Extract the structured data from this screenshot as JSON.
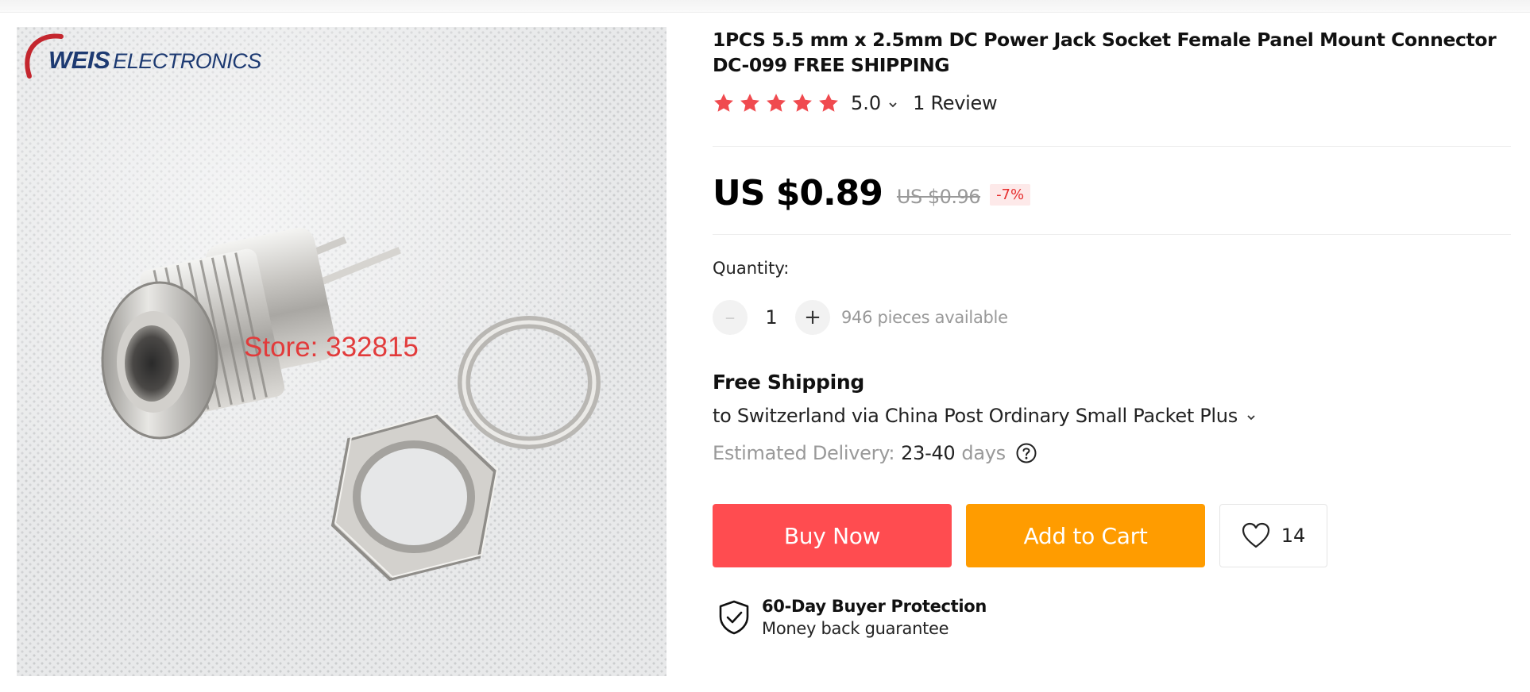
{
  "gallery": {
    "brand_main": "WEIS",
    "brand_sub": "ELECTRONICS",
    "watermark": "Store: 332815"
  },
  "product": {
    "title": "1PCS 5.5 mm x 2.5mm DC Power Jack Socket Female Panel Mount Connector DC-099 FREE SHIPPING",
    "rating_value": "5.0",
    "rating_stars": 5,
    "reviews_label": "1 Review"
  },
  "price": {
    "current": "US $0.89",
    "original": "US $0.96",
    "discount": "-7%"
  },
  "quantity": {
    "label": "Quantity:",
    "value": "1",
    "minus_label": "–",
    "plus_label": "+",
    "available": "946 pieces available"
  },
  "shipping": {
    "title": "Free Shipping",
    "detail": "to Switzerland via China Post Ordinary Small Packet Plus",
    "delivery_label": "Estimated Delivery:",
    "delivery_value": "23-40",
    "delivery_unit": "days"
  },
  "actions": {
    "buy_now": "Buy Now",
    "add_to_cart": "Add to Cart",
    "wishlist_count": "14"
  },
  "protection": {
    "title": "60-Day Buyer Protection",
    "subtitle": "Money back guarantee"
  },
  "colors": {
    "buy_now": "#ff4c50",
    "add_to_cart": "#ff9c00",
    "star": "#f04a4f",
    "discount_text": "#e62e2e"
  },
  "icons": [
    "star-icon",
    "chevron-down-icon",
    "minus-icon",
    "plus-icon",
    "question-circle-icon",
    "heart-icon",
    "shield-check-icon"
  ]
}
